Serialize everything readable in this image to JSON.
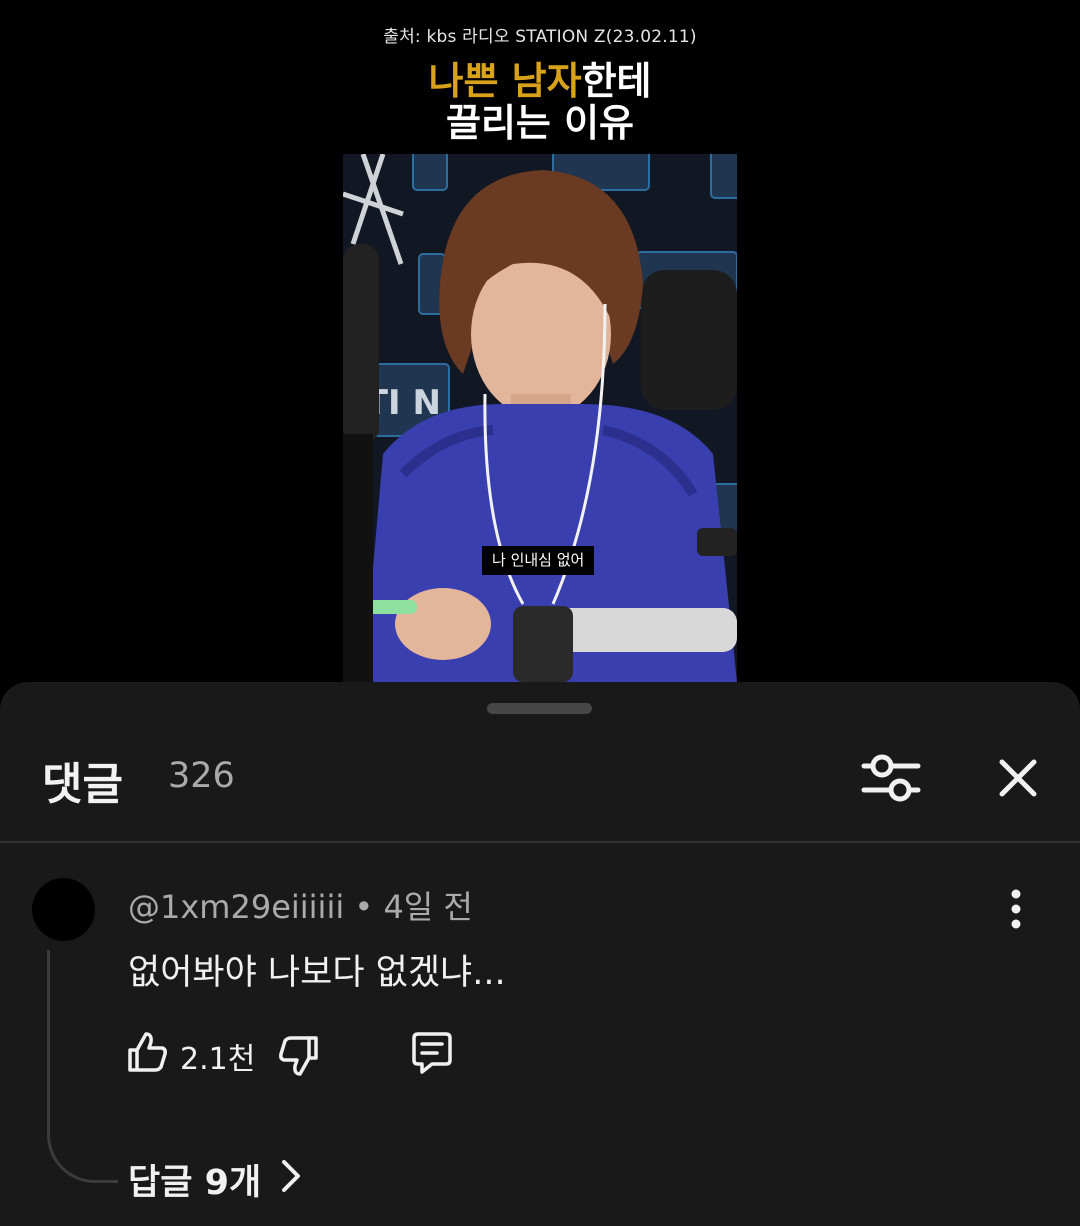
{
  "video": {
    "source_credit": "출처: kbs 라디오 STATION Z(23.02.11)",
    "title_line1_highlight": "나쁜 남자",
    "title_line1_rest": "한테",
    "title_line2": "끌리는 이유",
    "subtitle": "나 인내심 없어",
    "frame_backdrop_text": "STATION"
  },
  "comments_panel": {
    "title": "댓글",
    "count": "326",
    "filter_icon": "sliders-icon",
    "close_icon": "close-icon"
  },
  "comment": {
    "meta": "@1xm29eiiiiii • 4일 전",
    "text": "없어봐야 나보다 없겠냐...",
    "likes": "2.1천",
    "replies_label": "답글 9개",
    "icons": [
      "like-icon",
      "dislike-icon",
      "reply-icon",
      "more-vert-icon",
      "chevron-right-icon"
    ]
  },
  "colors": {
    "highlight": "#d9a21b",
    "sheet_bg": "#191919",
    "muted_text": "#aaaaaa",
    "jacket": "#3a3fb0"
  }
}
